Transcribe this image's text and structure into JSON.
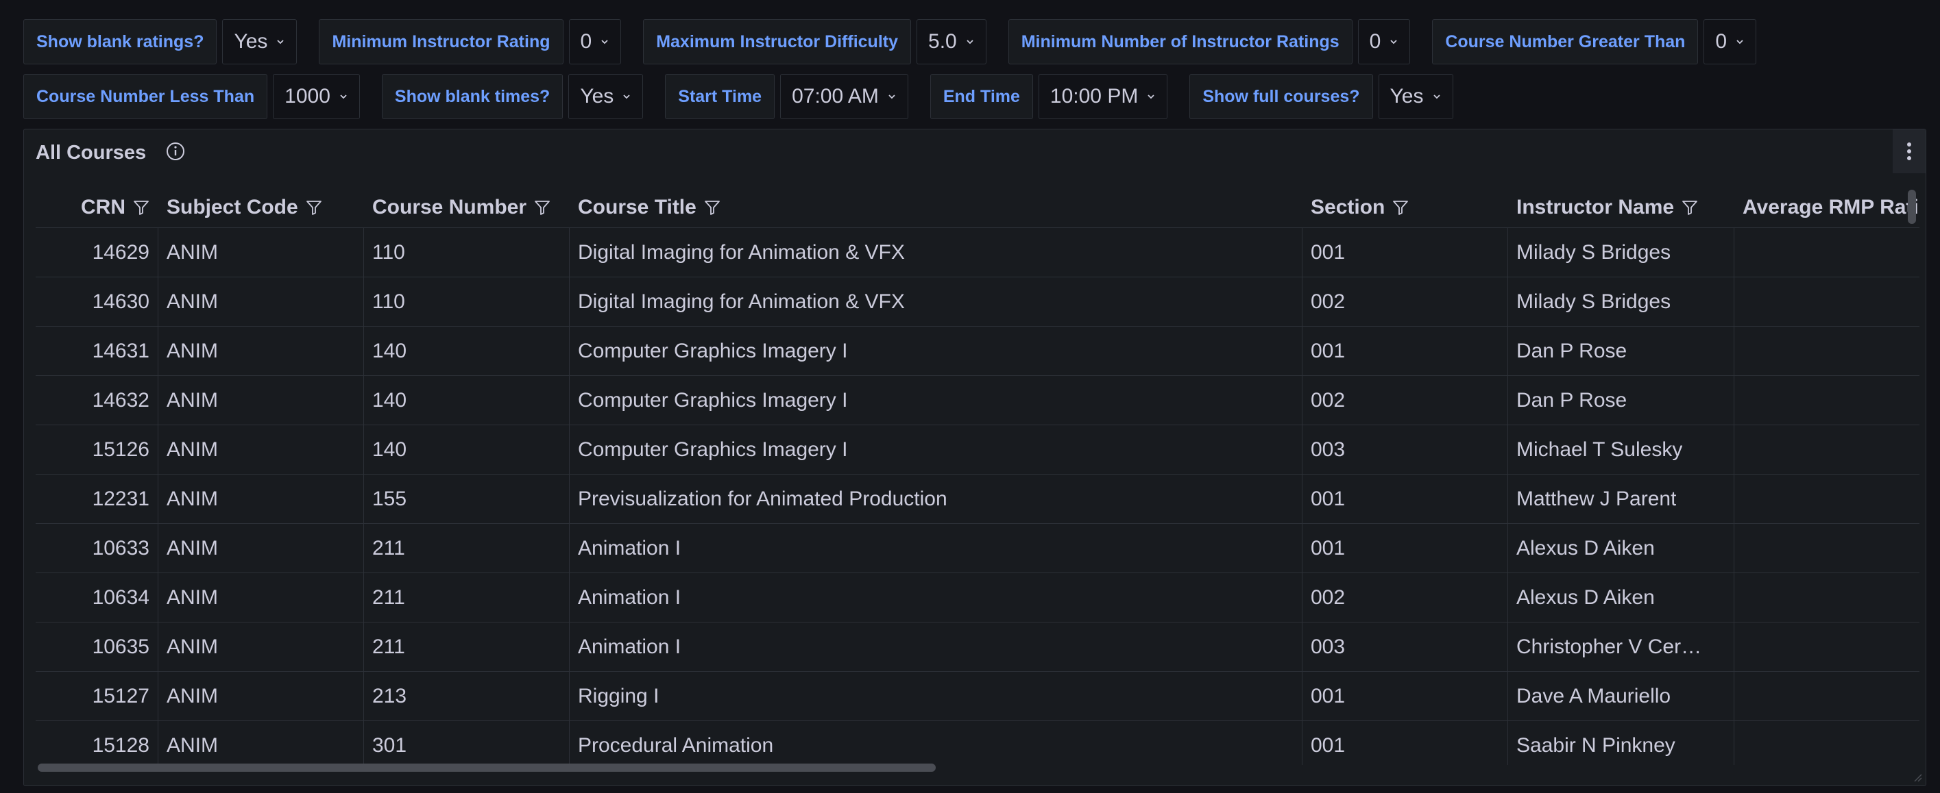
{
  "filters_row1": [
    {
      "label": "Show blank ratings?",
      "value": "Yes"
    },
    {
      "label": "Minimum Instructor Rating",
      "value": "0"
    },
    {
      "label": "Maximum Instructor Difficulty",
      "value": "5.0"
    },
    {
      "label": "Minimum Number of Instructor Ratings",
      "value": "0"
    },
    {
      "label": "Course Number Greater Than",
      "value": "0"
    }
  ],
  "filters_row2": [
    {
      "label": "Course Number Less Than",
      "value": "1000"
    },
    {
      "label": "Show blank times?",
      "value": "Yes"
    },
    {
      "label": "Start Time",
      "value": "07:00 AM"
    },
    {
      "label": "End Time",
      "value": "10:00 PM"
    },
    {
      "label": "Show full courses?",
      "value": "Yes"
    }
  ],
  "panel": {
    "title": "All Courses",
    "icons": {
      "info": "info-icon",
      "menu": "vertical-ellipsis-icon",
      "filter": "filter-icon"
    }
  },
  "table": {
    "columns": [
      "CRN",
      "Subject Code",
      "Course Number",
      "Course Title",
      "Section",
      "Instructor Name",
      "Average RMP Rating"
    ],
    "rows": [
      [
        "14629",
        "ANIM",
        "110",
        "Digital Imaging for Animation & VFX",
        "001",
        "Milady S Bridges",
        ""
      ],
      [
        "14630",
        "ANIM",
        "110",
        "Digital Imaging for Animation & VFX",
        "002",
        "Milady S Bridges",
        ""
      ],
      [
        "14631",
        "ANIM",
        "140",
        "Computer Graphics Imagery I",
        "001",
        "Dan P Rose",
        ""
      ],
      [
        "14632",
        "ANIM",
        "140",
        "Computer Graphics Imagery I",
        "002",
        "Dan P Rose",
        ""
      ],
      [
        "15126",
        "ANIM",
        "140",
        "Computer Graphics Imagery I",
        "003",
        "Michael T Sulesky",
        ""
      ],
      [
        "12231",
        "ANIM",
        "155",
        "Previsualization for Animated Production",
        "001",
        "Matthew J Parent",
        ""
      ],
      [
        "10633",
        "ANIM",
        "211",
        "Animation I",
        "001",
        "Alexus D Aiken",
        ""
      ],
      [
        "10634",
        "ANIM",
        "211",
        "Animation I",
        "002",
        "Alexus D Aiken",
        ""
      ],
      [
        "10635",
        "ANIM",
        "211",
        "Animation I",
        "003",
        "Christopher V Cer…",
        ""
      ],
      [
        "15127",
        "ANIM",
        "213",
        "Rigging I",
        "001",
        "Dave A Mauriello",
        ""
      ],
      [
        "15128",
        "ANIM",
        "301",
        "Procedural Animation",
        "001",
        "Saabir N Pinkney",
        ""
      ]
    ]
  },
  "colors": {
    "background": "#111217",
    "panel": "#181b1f",
    "label_accent": "#6e9fff",
    "text": "#ccccdc",
    "border": "#2c3037"
  }
}
